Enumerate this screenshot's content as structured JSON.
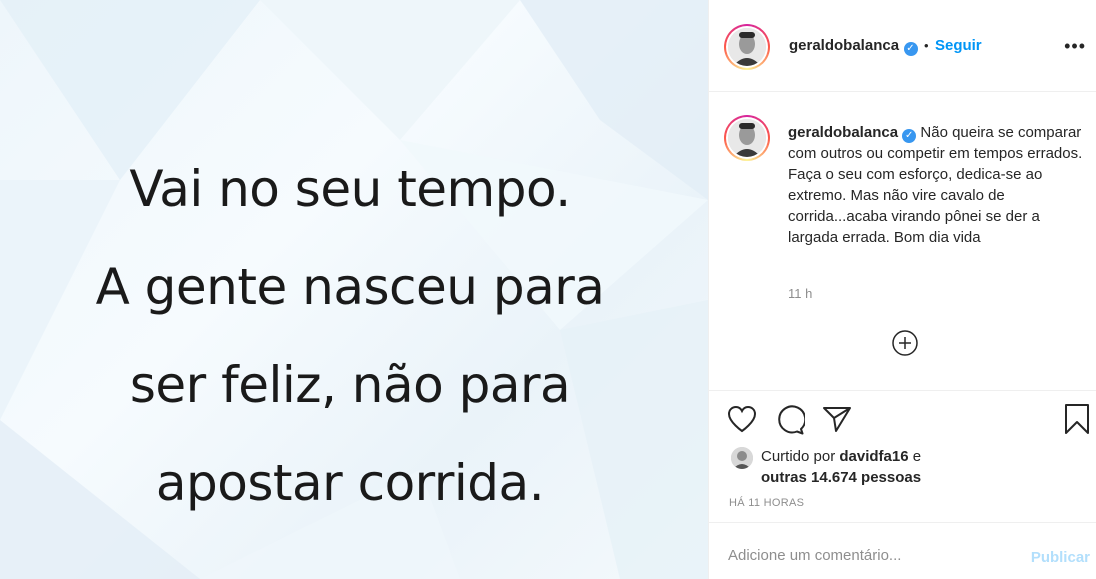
{
  "post": {
    "quote_lines": [
      "Vai no seu tempo.",
      "A gente nasceu para",
      "ser feliz, não para",
      "apostar corrida."
    ]
  },
  "header": {
    "username": "geraldobalanca",
    "verified_icon": "verified-badge-icon",
    "separator": "•",
    "follow_label": "Seguir",
    "more_icon": "•••"
  },
  "caption": {
    "username": "geraldobalanca",
    "text": "Não queira se comparar com outros ou competir em tempos errados. Faça o seu com esforço, dedica-se ao extremo. Mas não vire cavalo de corrida...acaba virando pônei se der a largada errada. Bom dia vida",
    "time": "11 h"
  },
  "actions": {
    "icons": [
      "heart-icon",
      "comment-icon",
      "share-icon",
      "bookmark-icon"
    ],
    "liked_by_prefix": "Curtido por",
    "liked_by_user": "davidfa16",
    "liked_by_and": "e",
    "others": "outras 14.674 pessoas",
    "posted_ago": "HÁ 11 HORAS"
  },
  "comment": {
    "placeholder": "Adicione um comentário...",
    "publish_label": "Publicar"
  },
  "colors": {
    "accent": "#0095f6",
    "publish_disabled": "#b2dffc",
    "muted": "#8e8e8e",
    "verified": "#3897f0"
  }
}
